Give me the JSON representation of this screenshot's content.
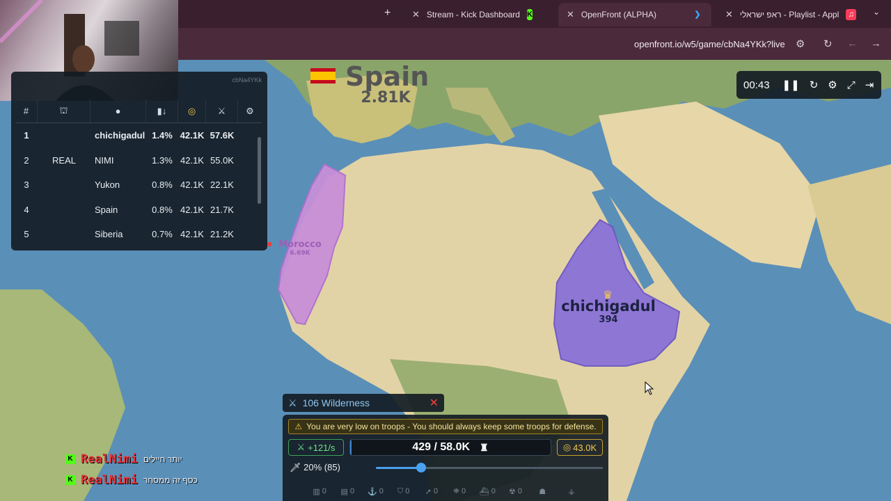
{
  "browser": {
    "tabs": [
      {
        "title": "Stream - Kick Dashboard",
        "favicon": "kick-icon"
      },
      {
        "title": "OpenFront (ALPHA)",
        "favicon": "openfront-icon",
        "active": true
      },
      {
        "title": "ראפ ישראלי - Playlist - Appl",
        "favicon": "music-icon"
      }
    ],
    "url": "openfront.io/w5/game/cbNa4YKk?live"
  },
  "leaderboard": {
    "game_id": "cbNa4YKk",
    "columns": [
      "#",
      "clan-icon",
      "player-icon",
      "tiles-sort-icon",
      "gold-icon",
      "troops-icon",
      "settings-icon"
    ],
    "rank_header": "#",
    "rows": [
      {
        "rank": "1",
        "clan": "",
        "name": "chichigadul",
        "share": "1.4%",
        "gold": "42.1K",
        "troops": "57.6K"
      },
      {
        "rank": "2",
        "clan": "REAL",
        "name": "NIMI",
        "share": "1.3%",
        "gold": "42.1K",
        "troops": "55.0K"
      },
      {
        "rank": "3",
        "clan": "",
        "name": "Yukon",
        "share": "0.8%",
        "gold": "42.1K",
        "troops": "22.1K"
      },
      {
        "rank": "4",
        "clan": "",
        "name": "Spain",
        "share": "0.8%",
        "gold": "42.1K",
        "troops": "21.7K"
      },
      {
        "rank": "5",
        "clan": "",
        "name": "Siberia",
        "share": "0.7%",
        "gold": "42.1K",
        "troops": "21.2K"
      }
    ]
  },
  "timer": {
    "time": "00:43",
    "controls": [
      "pause-icon",
      "restart-icon",
      "settings-icon",
      "fullscreen-icon",
      "exit-icon"
    ]
  },
  "map": {
    "labels": [
      {
        "name": "Spain",
        "troops": "2.81K"
      },
      {
        "name": "Morocco",
        "troops": "6.69K"
      },
      {
        "name": "chichigadul",
        "troops": "394"
      }
    ],
    "colors": {
      "ocean": "#5a8fb8",
      "land": "#e2d3a6",
      "morocco": "#c78fd8",
      "player": "#8a72d8"
    }
  },
  "hover_target": {
    "label": "106 Wilderness"
  },
  "control_panel": {
    "warning": "You are very low on troops - You should always keep some troops for defense.",
    "troop_rate": "+121/s",
    "troops": "429 / 58.0K",
    "troop_fill_fraction": 0.007,
    "gold": "43.0K",
    "attack_ratio_label": "20% (85)",
    "attack_ratio": 0.2,
    "build_counts": [
      "0",
      "0",
      "0",
      "0",
      "0",
      "0",
      "0",
      "0",
      ""
    ]
  },
  "chat": [
    {
      "user": "RealNimi",
      "message": "יותר חיילים"
    },
    {
      "user": "RealNimi",
      "message": "כסף זה ממסחר"
    }
  ]
}
